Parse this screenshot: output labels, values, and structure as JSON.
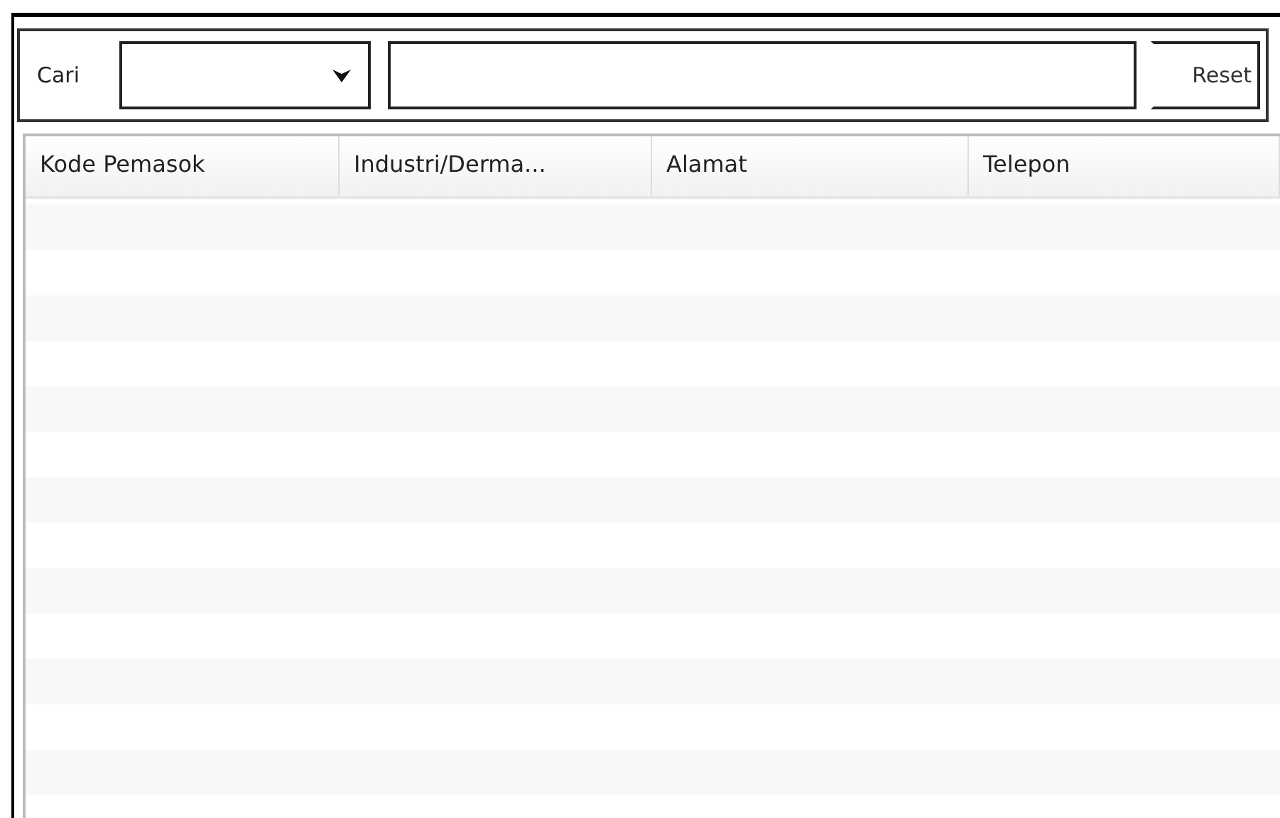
{
  "search_bar": {
    "label": "Cari",
    "reset_button": "Reset"
  },
  "table": {
    "columns": [
      "Kode Pemasok",
      "Industri/Derma...",
      "Alamat",
      "Telepon"
    ]
  }
}
